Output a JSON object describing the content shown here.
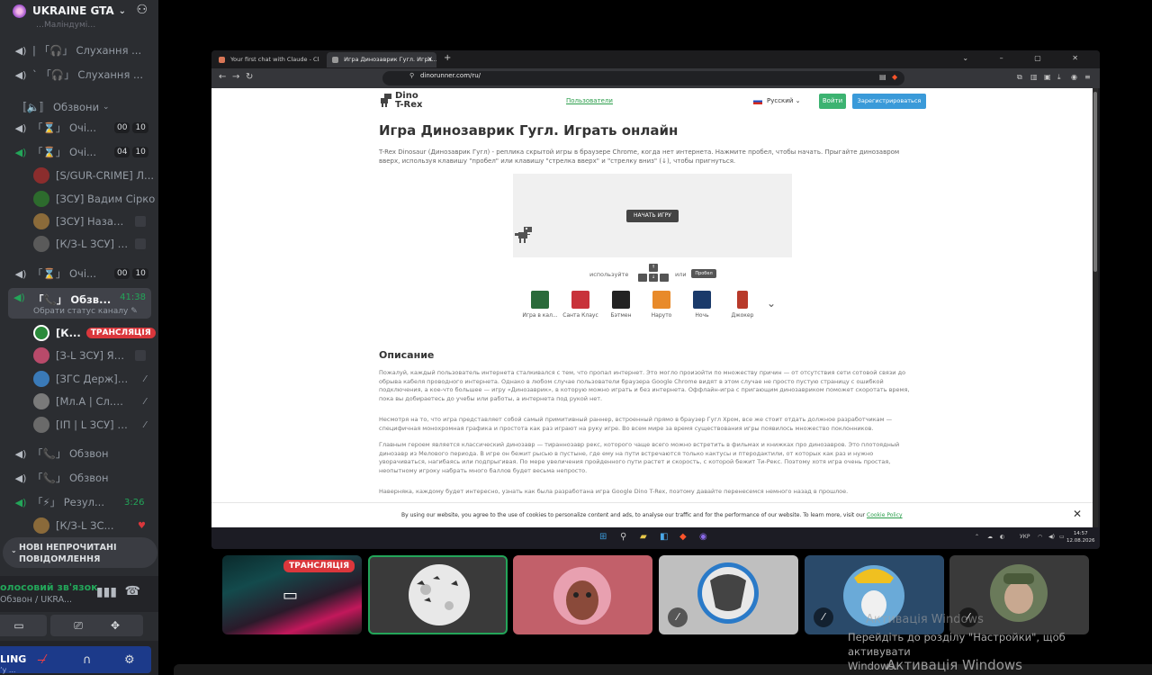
{
  "sidebar": {
    "server_name": "UKRAINE GTA",
    "top_cut_label": "…Маліндумі…",
    "rows": [
      {
        "icon": "speaker-icon",
        "label": "| 「🎧」 Слухання ...",
        "indent": 0
      },
      {
        "icon": "speaker-icon",
        "label": "ˋ 「🎧」 Слухання ...",
        "indent": 0
      },
      {
        "icon": "category-icon",
        "label": "〚🔈〛 Обзвони",
        "indent": 0,
        "chev": "⌄"
      },
      {
        "icon": "speaker-icon",
        "label": "「⌛」 Очі...",
        "a": "00",
        "b": "10"
      },
      {
        "icon": "speaker-green-icon",
        "label": "「⌛」 Очі...",
        "a": "04",
        "b": "10"
      }
    ],
    "users_1": [
      {
        "name": "[S/GUR-CRIME] Л...",
        "color": "#8b2d2d"
      },
      {
        "name": "[ЗСУ] Вадим Сірко",
        "color": "#2d6b2d"
      },
      {
        "name": "[ЗСУ] Назар Г...",
        "color": "#8b6b3a"
      },
      {
        "name": "[К/З-L ЗСУ] В...",
        "color": "#5a5a5a"
      }
    ],
    "row_och3": {
      "label": "「⌛」 Очі...",
      "a": "00",
      "b": "10"
    },
    "active_channel": {
      "label": "「📞」 Обзв...",
      "time": "41:38",
      "sub": "Обрати статус каналу ✎"
    },
    "users_2": [
      {
        "name": "[К...",
        "live": "ТРАНСЛЯЦІЯ",
        "color": "#2a8a3a",
        "white": true
      },
      {
        "name": "[З-L ЗСУ] Яся ...",
        "color": "#b84a6a"
      },
      {
        "name": "[ЗГС Держ] В...",
        "color": "#3a7ab8"
      },
      {
        "name": "[Мл.А | Сл.ЗС...",
        "color": "#7a7a7a"
      },
      {
        "name": "[ІП | L ЗСУ] Ол...",
        "color": "#6a6a6a"
      }
    ],
    "lower_rows": [
      {
        "label": "「📞」 Обзвон",
        "green": false
      },
      {
        "label": "「📞」 Обзвон",
        "green": false
      },
      {
        "label": "「⚡」 Резул...",
        "green": true,
        "time": "3:26"
      }
    ],
    "last_user": {
      "name": "[К/З-L ЗС...",
      "color": "#8a6a3a"
    },
    "unread_banner": "НОВІ НЕПРОЧИТАНІ ПОВІДОМЛЕННЯ",
    "voice_status": "олосовий зв'язок",
    "voice_channel": "Обзвон / UKRA...",
    "user_name": "LING",
    "user_status": "ʼу ...",
    "colors": {
      "bg": "#2b2d31",
      "green": "#23a559",
      "red": "#da373c"
    }
  },
  "browser": {
    "tabs": [
      {
        "label": "Your first chat with Claude - Claude",
        "active": false
      },
      {
        "label": "Игра Динозаврик Гугл. Игра...",
        "active": true
      }
    ],
    "url": "dinorunner.com/ru/",
    "site": {
      "logo_line1": "Dino",
      "logo_line2": "T-Rex",
      "nav_users": "Пользователи",
      "language": "Русский",
      "login": "Войти",
      "register": "Зарегистрироваться",
      "title": "Игра Динозаврик Гугл. Играть онлайн",
      "intro": "T-Rex Dinosaur (Динозаврик Гугл) - реплика скрытой игры в браузере Chrome, когда нет интернета. Нажмите пробел, чтобы начать. Прыгайте динозавром вверх, используя клавишу \"пробел\" или клавишу \"стрелка вверх\" и \"стрелку вниз\" (↓), чтобы пригнуться.",
      "start_button": "НАЧАТЬ ИГРУ",
      "use_label": "используйте",
      "or_label": "или",
      "space_key": "Пробел",
      "skins": [
        {
          "name": "Игра в кал...",
          "color": "#2a6a3a"
        },
        {
          "name": "Санта Клаус",
          "color": "#c8323a"
        },
        {
          "name": "Бэтмен",
          "color": "#222"
        },
        {
          "name": "Наруто",
          "color": "#e88a2a"
        },
        {
          "name": "Ночь",
          "color": "#1a3a6a"
        },
        {
          "name": "Джокер",
          "color": "#b83a2a"
        }
      ],
      "description_heading": "Описание",
      "paragraphs": [
        "Пожалуй, каждый пользователь интернета сталкивался с тем, что пропал интернет. Это могло произойти по множеству причин — от отсутствия сети сотовой связи до обрыва кабеля проводного интернета. Однако в любом случае пользователи браузера Google Chrome видят в этом случае не просто пустую страницу с ошибкой подключения, а кое-что большее — игру «Динозаврик», в которую можно играть и без интернета. Оффлайн-игра с пригающим динозавриком поможет скоротать время, пока вы добираетесь до учебы или работы, а интернета под рукой нет.",
        "Несмотря на то, что игра представляет собой самый примитивный раннер, встроенный прямо в браузер Гугл Хром, все же стоит отдать должное разработчикам — специфичная монохромная графика и простота как раз играют на руку игре. Во всем мире за время существования игры появилось множество поклонников.",
        "Главным героем является классический динозавр — тираннозавр рекс, которого чаще всего можно встретить в фильмах и книжках про динозавров. Это плотоядный динозавр из Мелового периода. В игре он бежит рысью в пустыне, где ему на пути встречаются только кактусы и птеродактили, от которых как раз и нужно уворачиваться, нагибаясь или подпрыгивая. По мере увеличения пройденного пути растет и скорость, с которой бежит Ти-Рекс. Поэтому хотя игра очень простая, неопытному игроку набрать много баллов будет весьма непросто.",
        "Наверняка, каждому будет интересно, узнать как была разработана игра Google Dino T-Rex, поэтому давайте перенесемся немного назад в прошлое."
      ],
      "cookie_text": "By using our website, you agree to the use of cookies to personalize content and ads, to analyse our traffic and for the performance of our website. To learn more, visit our",
      "cookie_link": "Cookie Policy",
      "cookie_close": "✕"
    },
    "taskbar": {
      "lang": "УКР",
      "time": "14:57",
      "date": "12.08.2026"
    }
  },
  "tiles": [
    {
      "name": "stream-tile",
      "live": "ТРАНСЛЯЦІЯ"
    },
    {
      "name": "moon-avatar-tile"
    },
    {
      "name": "pink-avatar-tile"
    },
    {
      "name": "anime-avatar-tile",
      "muted": true
    },
    {
      "name": "cat-avatar-tile",
      "muted": true
    },
    {
      "name": "soldier-avatar-tile",
      "muted": true
    }
  ],
  "watermark": {
    "ghost": "Активація Windows",
    "line1": "Перейдіть до розділу \"Настройки\", щоб активувати",
    "line2": "Windows.",
    "title": "Активація Windows"
  }
}
